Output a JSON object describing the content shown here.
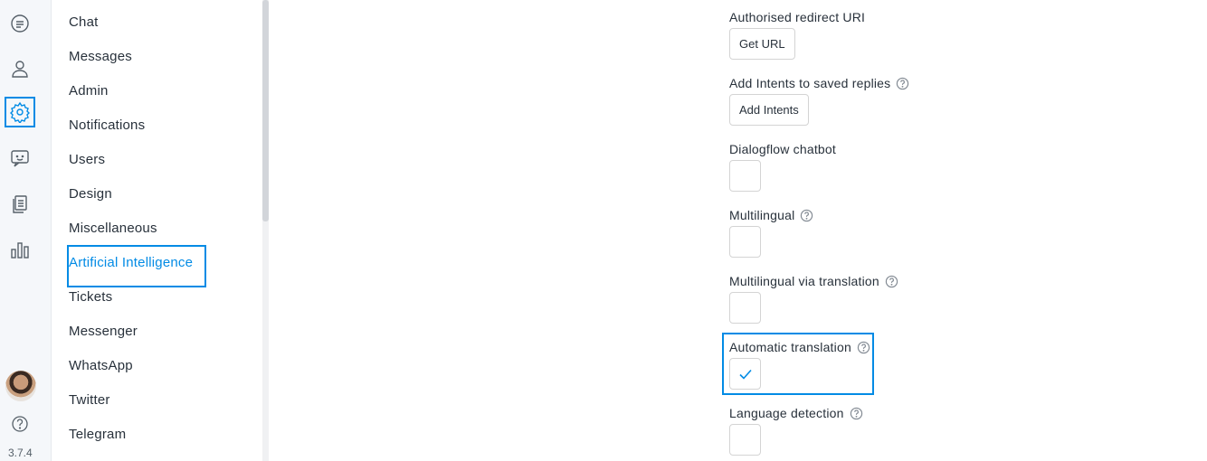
{
  "rail": {
    "items": [
      {
        "name": "conversations-icon",
        "active": false
      },
      {
        "name": "users-icon",
        "active": false
      },
      {
        "name": "settings-icon",
        "active": true
      },
      {
        "name": "chatbot-icon",
        "active": false
      },
      {
        "name": "articles-icon",
        "active": false
      },
      {
        "name": "reports-icon",
        "active": false
      }
    ],
    "version": "3.7.4"
  },
  "nav": {
    "items": [
      {
        "label": "Chat"
      },
      {
        "label": "Messages"
      },
      {
        "label": "Admin"
      },
      {
        "label": "Notifications"
      },
      {
        "label": "Users"
      },
      {
        "label": "Design"
      },
      {
        "label": "Miscellaneous"
      },
      {
        "label": "Artificial Intelligence",
        "active": true
      },
      {
        "label": "Tickets"
      },
      {
        "label": "Messenger"
      },
      {
        "label": "WhatsApp"
      },
      {
        "label": "Twitter"
      },
      {
        "label": "Telegram"
      }
    ]
  },
  "settings": {
    "redirect_uri": {
      "label": "Authorised redirect URI",
      "button": "Get URL"
    },
    "intents": {
      "label": "Add Intents to saved replies",
      "button": "Add Intents"
    },
    "dialogflow": {
      "label": "Dialogflow chatbot",
      "checked": false
    },
    "multilingual": {
      "label": "Multilingual",
      "checked": false
    },
    "multilingual_translation": {
      "label": "Multilingual via translation",
      "checked": false
    },
    "auto_translation": {
      "label": "Automatic translation",
      "checked": true
    },
    "language_detection": {
      "label": "Language detection",
      "checked": false
    }
  },
  "colors": {
    "accent": "#028be5",
    "text": "#28313b"
  }
}
